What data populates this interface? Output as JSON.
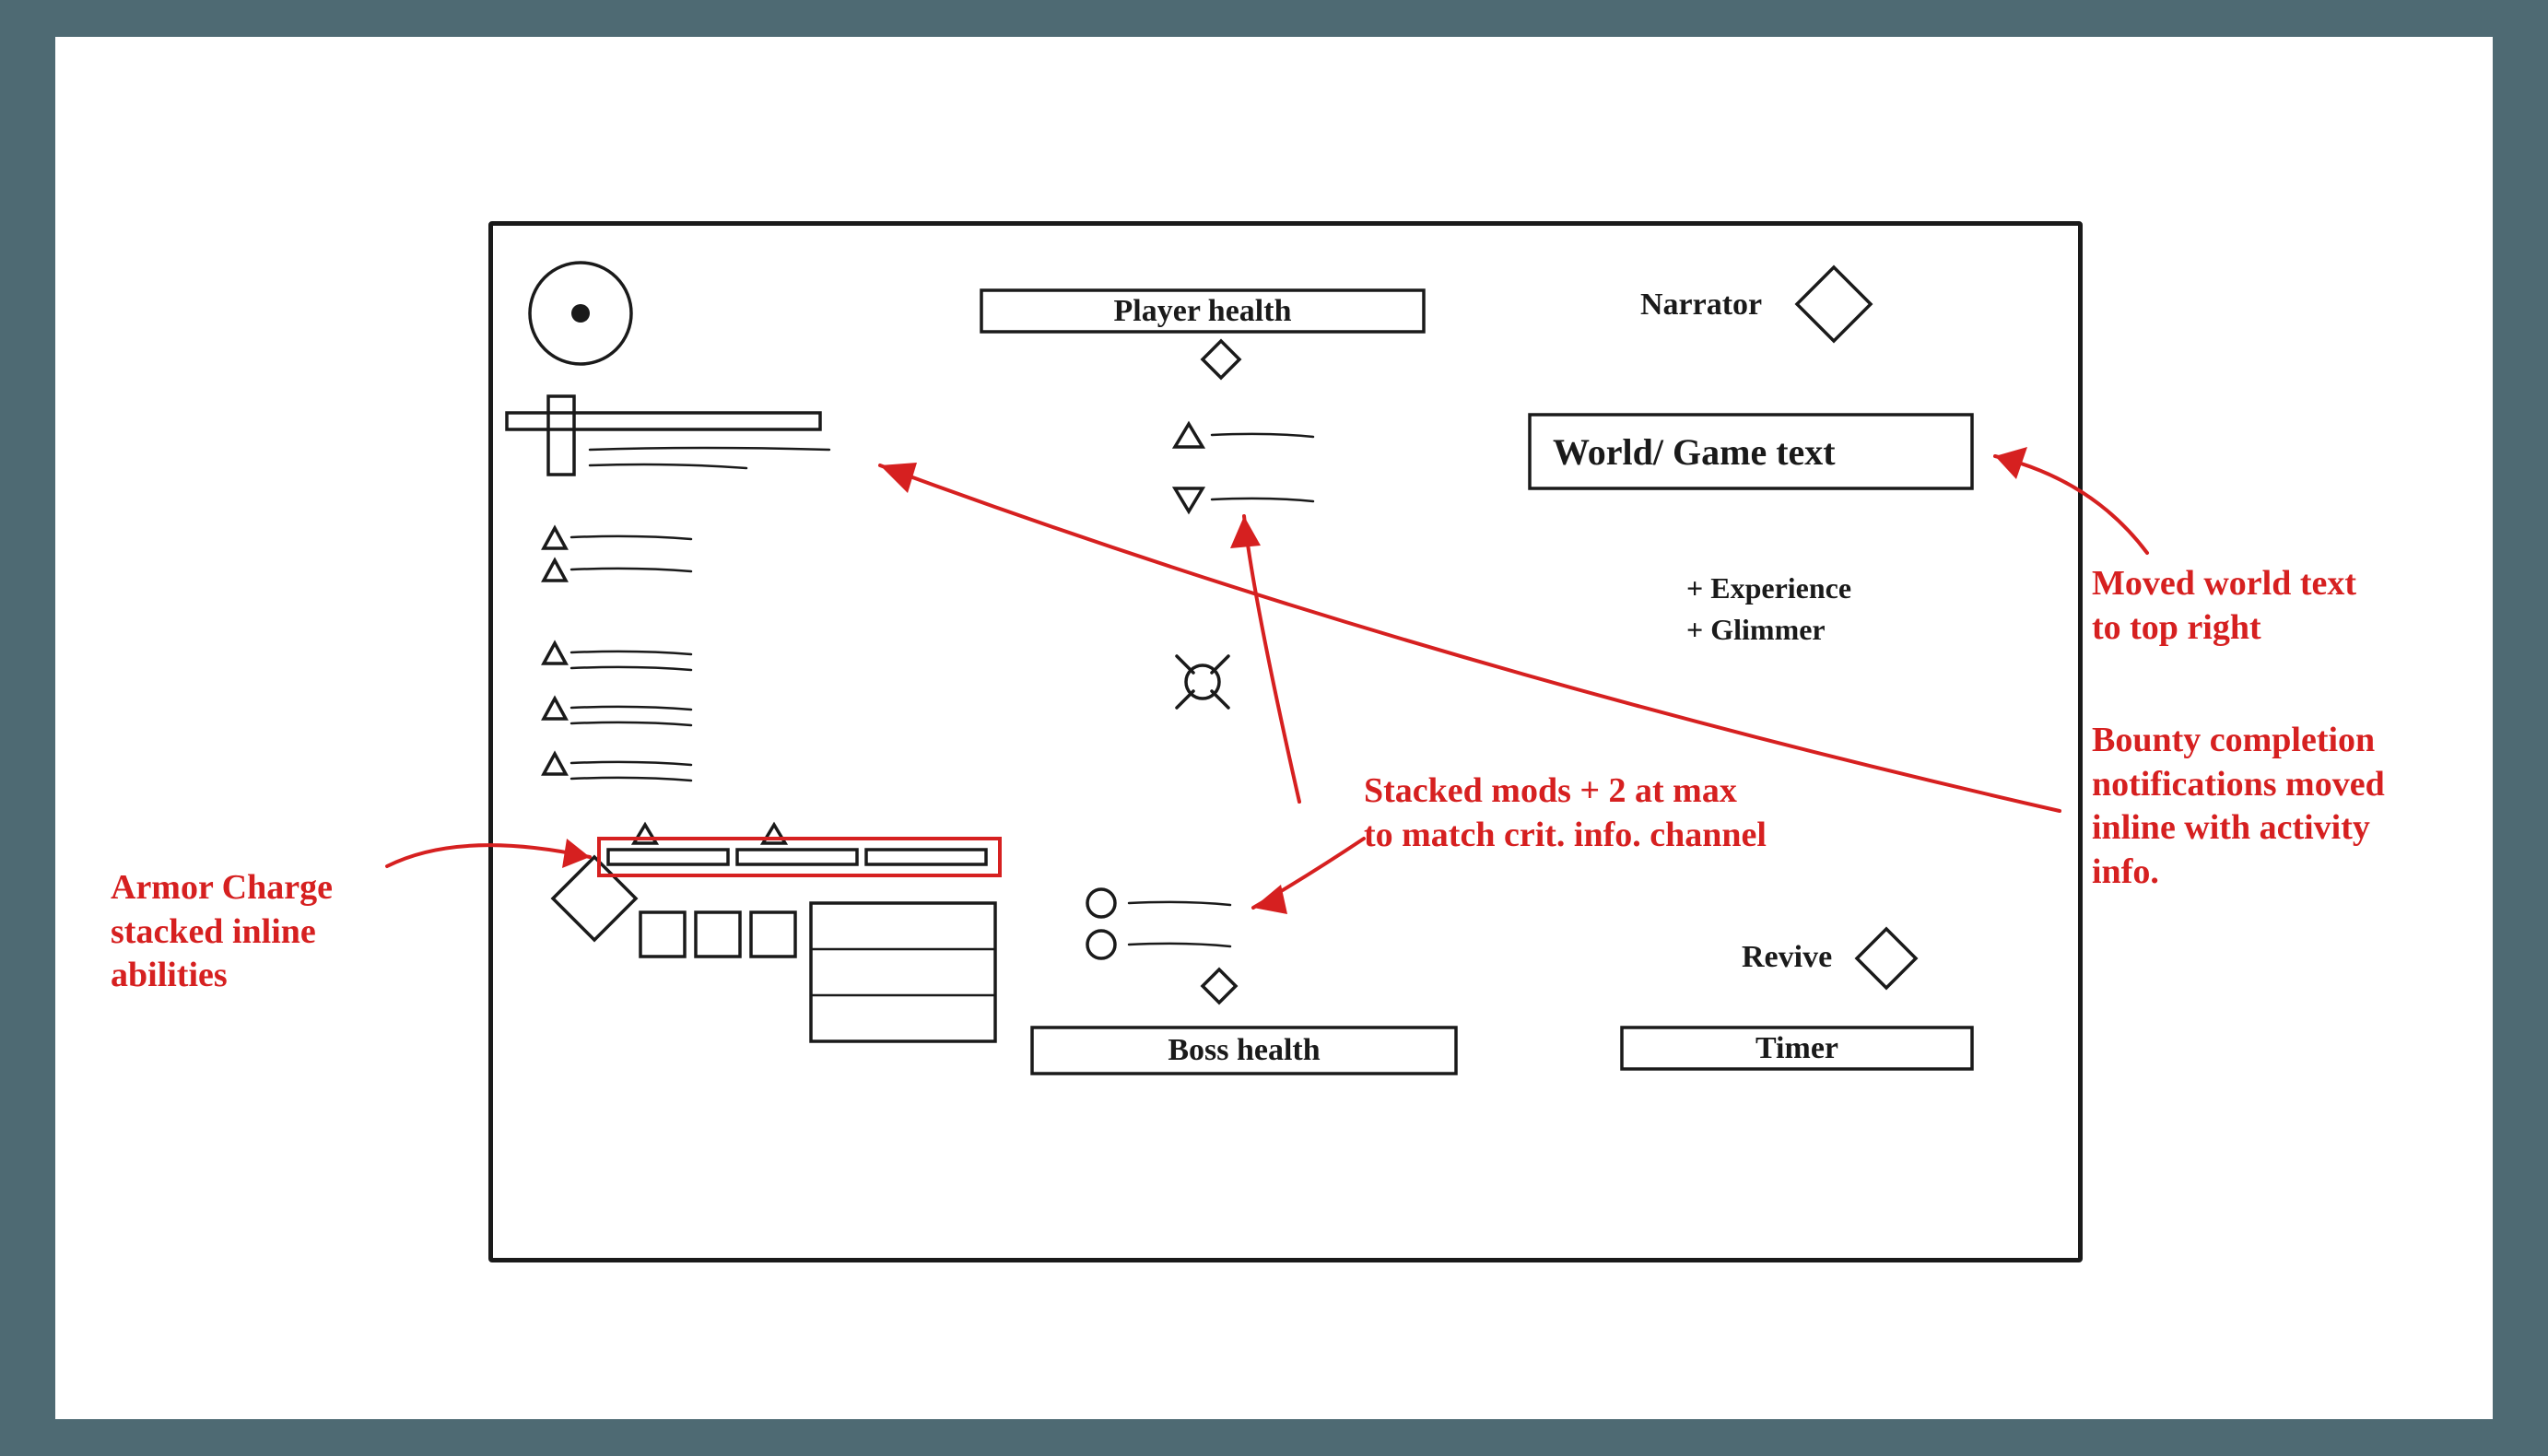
{
  "hud": {
    "player_health": "Player health",
    "narrator": "Narrator",
    "world_text": "World/ Game text",
    "experience": "+ Experience",
    "glimmer": "+ Glimmer",
    "revive": "Revive",
    "timer": "Timer",
    "boss_health": "Boss health"
  },
  "annotations": {
    "armor_charge": "Armor Charge\nstacked inline\nabilities",
    "stacked_mods": "Stacked mods + 2 at max\nto match crit. info. channel",
    "moved_world": "Moved world text\nto top right",
    "bounty": "Bounty completion\nnotifications moved\ninline with activity\ninfo."
  }
}
